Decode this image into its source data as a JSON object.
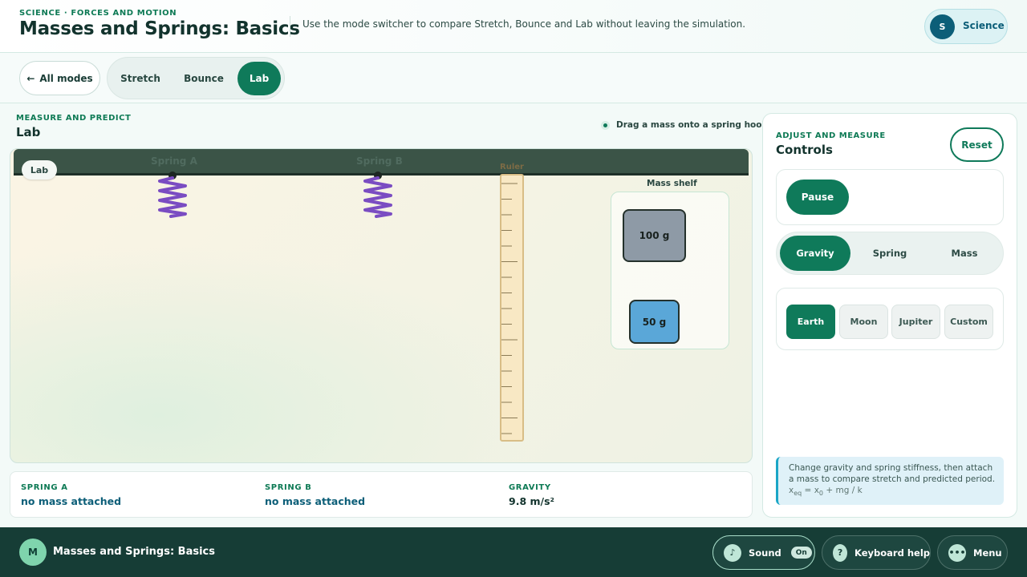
{
  "header": {
    "kicker": "SCIENCE · FORCES AND MOTION",
    "title": "Masses and Springs: Basics",
    "subtitle": "Use the mode switcher to compare Stretch, Bounce and Lab without leaving the simulation.",
    "account": {
      "initial": "S",
      "label": "Science"
    }
  },
  "modebar": {
    "all_modes_label": "All modes",
    "modes": [
      {
        "label": "Stretch",
        "active": false
      },
      {
        "label": "Bounce",
        "active": false
      },
      {
        "label": "Lab",
        "active": true
      }
    ]
  },
  "stage": {
    "kicker": "MEASURE AND PREDICT",
    "title": "Lab",
    "hint": "Drag a mass onto a spring hook.",
    "chip": "Lab",
    "springs": [
      {
        "label": "Spring A"
      },
      {
        "label": "Spring B"
      }
    ],
    "ruler_label": "Ruler",
    "shelf_label": "Mass shelf",
    "masses": [
      {
        "label": "100 g",
        "color": "#8e9aa6"
      },
      {
        "label": "50 g",
        "color": "#5aa7d8"
      }
    ]
  },
  "status": {
    "spring_a_label": "SPRING A",
    "spring_a_value": "no mass attached",
    "spring_b_label": "SPRING B",
    "spring_b_value": "no mass attached",
    "gravity_label": "GRAVITY",
    "gravity_value": "9.8 m/s²"
  },
  "controls": {
    "kicker": "ADJUST AND MEASURE",
    "title": "Controls",
    "reset_label": "Reset",
    "pause_label": "Pause",
    "tabs": [
      {
        "label": "Gravity",
        "active": true
      },
      {
        "label": "Spring",
        "active": false
      },
      {
        "label": "Mass",
        "active": false
      }
    ],
    "gravity_options": [
      {
        "label": "Earth",
        "active": true
      },
      {
        "label": "Moon",
        "active": false
      },
      {
        "label": "Jupiter",
        "active": false
      },
      {
        "label": "Custom",
        "active": false
      }
    ],
    "note": "Change gravity and spring stiffness, then attach a mass to compare stretch and predicted period.",
    "formula": "x_eq = x_0 + mg / k"
  },
  "footer": {
    "initial": "M",
    "title": "Masses and Springs: Basics",
    "sound_label": "Sound",
    "sound_state": "On",
    "keyboard_label": "Keyboard help",
    "menu_label": "Menu",
    "icons": {
      "sound": "music-note-icon",
      "keyboard": "question-icon",
      "menu": "more-dots-icon"
    }
  },
  "colors": {
    "accent": "#0f7a5a",
    "footer_bg": "#163d36",
    "spring": "#7a4cc2"
  }
}
